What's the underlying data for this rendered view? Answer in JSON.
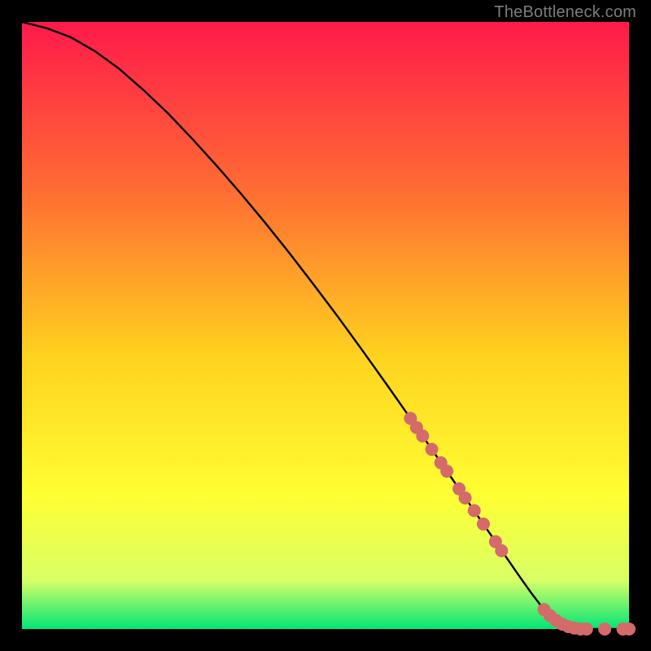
{
  "watermark": "TheBottleneck.com",
  "colors": {
    "bg": "#000000",
    "watermark": "#7d7d7d",
    "curve": "#000000",
    "dot": "#d46a6a",
    "gradient_top": "#ff1a4b",
    "gradient_mid1": "#ff6d33",
    "gradient_mid2": "#ffd21f",
    "gradient_mid3": "#ffff33",
    "gradient_mid4": "#d8ff66",
    "gradient_bottom": "#00e676"
  },
  "chart_data": {
    "type": "line",
    "title": "",
    "xlabel": "",
    "ylabel": "",
    "xlim": [
      0,
      100
    ],
    "ylim": [
      0,
      100
    ],
    "series": [
      {
        "name": "curve",
        "x": [
          0,
          4,
          8,
          12,
          16,
          20,
          24,
          28,
          32,
          36,
          40,
          44,
          48,
          52,
          56,
          60,
          64,
          68,
          72,
          76,
          80,
          82,
          84,
          86,
          88,
          90,
          92,
          94,
          96,
          98,
          100
        ],
        "y": [
          100,
          99,
          97.5,
          95.2,
          92.3,
          88.8,
          85,
          80.8,
          76.4,
          71.8,
          67,
          62,
          56.8,
          51.5,
          46,
          40.4,
          34.7,
          28.9,
          23.1,
          17.3,
          11.5,
          8.6,
          5.8,
          3.2,
          1.4,
          0.4,
          0,
          0,
          0,
          0,
          0
        ]
      }
    ],
    "dots": {
      "name": "highlight-points",
      "points": [
        {
          "x": 64,
          "y": 34.7
        },
        {
          "x": 65,
          "y": 33.2
        },
        {
          "x": 66,
          "y": 31.8
        },
        {
          "x": 67.5,
          "y": 29.6
        },
        {
          "x": 69,
          "y": 27.4
        },
        {
          "x": 70,
          "y": 26.0
        },
        {
          "x": 72,
          "y": 23.1
        },
        {
          "x": 73,
          "y": 21.6
        },
        {
          "x": 74.5,
          "y": 19.5
        },
        {
          "x": 76,
          "y": 17.3
        },
        {
          "x": 78,
          "y": 14.4
        },
        {
          "x": 79,
          "y": 12.9
        },
        {
          "x": 86,
          "y": 3.2
        },
        {
          "x": 87,
          "y": 2.2
        },
        {
          "x": 88,
          "y": 1.4
        },
        {
          "x": 89,
          "y": 0.8
        },
        {
          "x": 90,
          "y": 0.4
        },
        {
          "x": 91,
          "y": 0.15
        },
        {
          "x": 92,
          "y": 0
        },
        {
          "x": 93,
          "y": 0
        },
        {
          "x": 96,
          "y": 0
        },
        {
          "x": 99,
          "y": 0
        },
        {
          "x": 100,
          "y": 0
        }
      ]
    }
  }
}
